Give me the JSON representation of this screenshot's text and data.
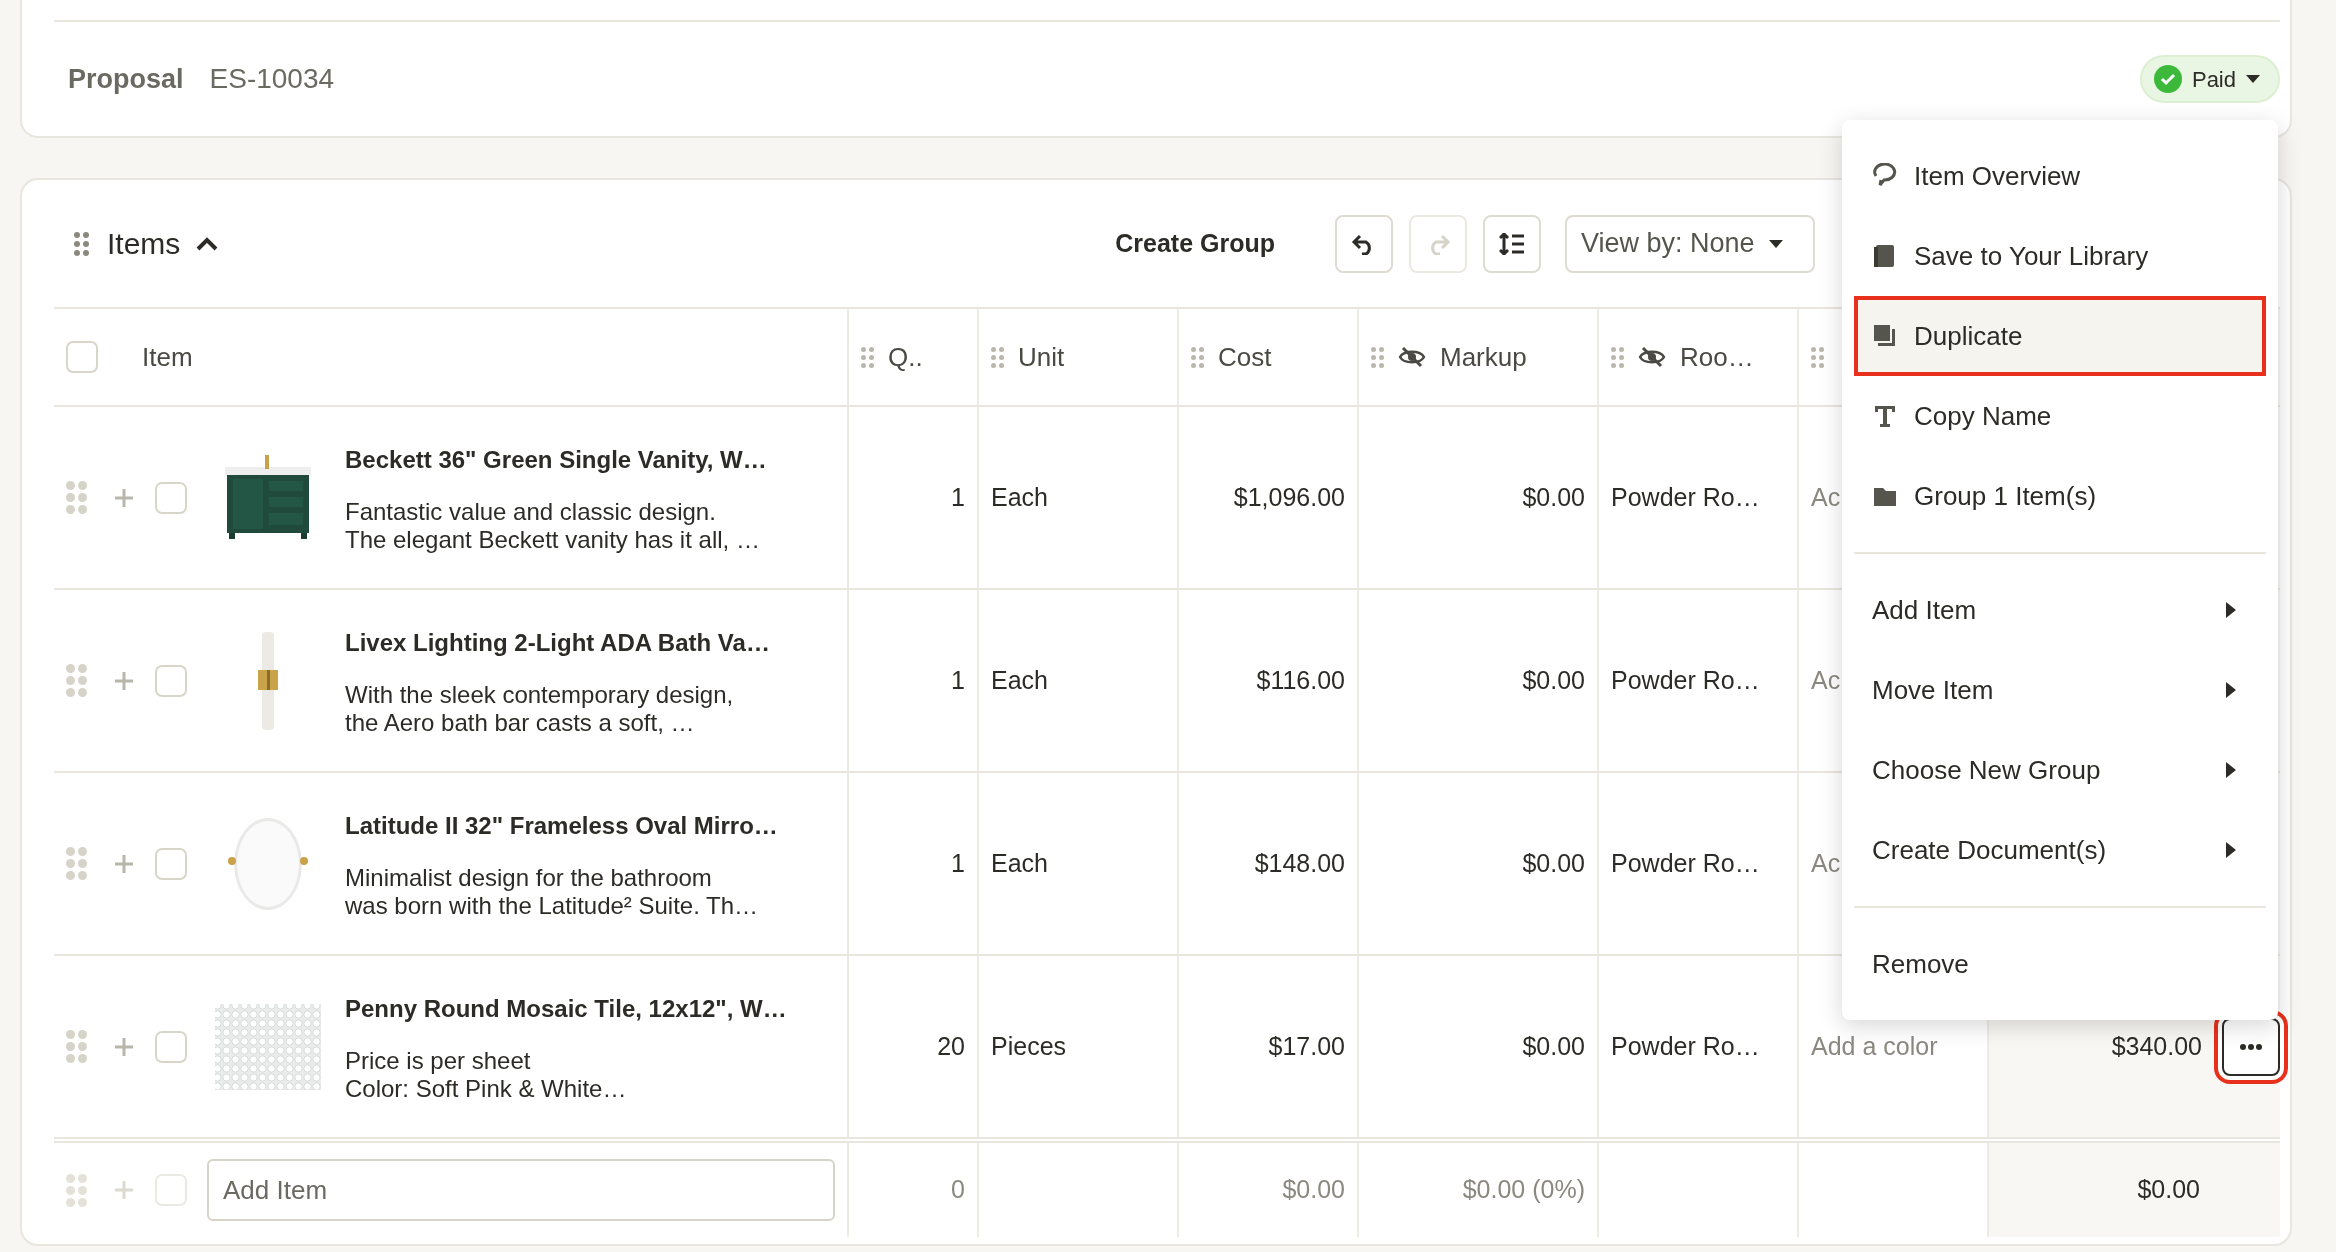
{
  "proposal": {
    "label": "Proposal",
    "number": "ES-10034",
    "status": {
      "label": "Paid",
      "color": "#3cb93a"
    }
  },
  "items_panel": {
    "title": "Items",
    "expanded": true,
    "header_checked": false,
    "toolbar": {
      "create_group": "Create Group",
      "undo_disabled": false,
      "redo_disabled": true,
      "view_by": "View by: None"
    },
    "columns": [
      {
        "label": "Item",
        "hidden": false,
        "kind": "item"
      },
      {
        "label": "Q..",
        "hidden": false,
        "kind": "data"
      },
      {
        "label": "Unit",
        "hidden": false,
        "kind": "data"
      },
      {
        "label": "Cost",
        "hidden": false,
        "kind": "data"
      },
      {
        "label": "Markup",
        "hidden": true,
        "kind": "data"
      },
      {
        "label": "Roo…",
        "hidden": true,
        "kind": "data"
      },
      {
        "hidden": false,
        "kind": "data"
      }
    ],
    "rows": [
      {
        "checked": false,
        "name": "Beckett 36\" Green Single Vanity, W…",
        "description": [
          "Fantastic value and classic design.",
          "The elegant Beckett vanity has it all, …"
        ],
        "quantity": "1",
        "unit": "Each",
        "cost": "$1,096.00",
        "markup": "$0.00",
        "room": "Powder Ro…",
        "color_text": "Ac",
        "color_empty": true
      },
      {
        "checked": false,
        "name": "Livex Lighting 2-Light ADA Bath Va…",
        "description": [
          "With the sleek contemporary design,",
          "the Aero bath bar casts a soft, …"
        ],
        "quantity": "1",
        "unit": "Each",
        "cost": "$116.00",
        "markup": "$0.00",
        "room": "Powder Ro…",
        "color_text": "Ac",
        "color_empty": true
      },
      {
        "checked": false,
        "name": "Latitude II 32\" Frameless Oval Mirro…",
        "description": [
          "Minimalist design for the bathroom",
          "was born with the Latitude² Suite. Th…"
        ],
        "quantity": "1",
        "unit": "Each",
        "cost": "$148.00",
        "markup": "$0.00",
        "room": "Powder Ro…",
        "color_text": "Ac",
        "color_empty": true
      },
      {
        "checked": false,
        "name": "Penny Round Mosaic Tile, 12x12\", W…",
        "description": [
          "Price is per sheet",
          "Color: Soft Pink & White…"
        ],
        "quantity": "20",
        "unit": "Pieces",
        "cost": "$17.00",
        "markup": "$0.00",
        "room": "Powder Ro…",
        "color_text": "Add a color",
        "color_empty": true,
        "total": "$340.00",
        "more_highlighted": true
      }
    ],
    "add_row": {
      "checked": false,
      "placeholder": "Add Item",
      "quantity": "0",
      "cost": "$0.00",
      "markup": "$0.00 (0%)",
      "total": "$0.00"
    }
  },
  "context_menu": {
    "sections": [
      [
        {
          "label": "Item Overview",
          "selected": false,
          "submenu": false
        },
        {
          "label": "Save to Your Library",
          "selected": false,
          "submenu": false
        },
        {
          "label": "Duplicate",
          "selected": true,
          "submenu": false
        },
        {
          "label": "Copy Name",
          "selected": false,
          "submenu": false
        },
        {
          "label": "Group 1 Item(s)",
          "selected": false,
          "submenu": false
        }
      ],
      [
        {
          "label": "Add Item",
          "selected": false,
          "submenu": true
        },
        {
          "label": "Move Item",
          "selected": false,
          "submenu": true
        },
        {
          "label": "Choose New Group",
          "selected": false,
          "submenu": true
        },
        {
          "label": "Create Document(s)",
          "selected": false,
          "submenu": true
        }
      ],
      [
        {
          "label": "Remove",
          "selected": false,
          "submenu": false
        }
      ]
    ]
  }
}
